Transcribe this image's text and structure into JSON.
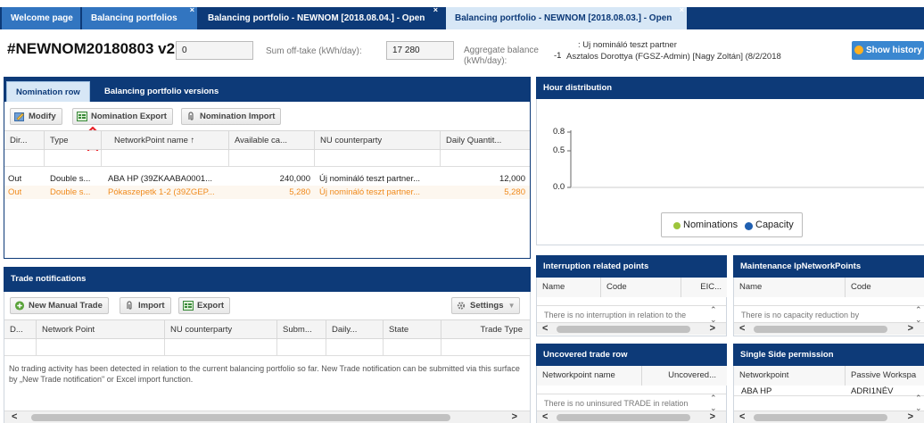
{
  "tabs": [
    {
      "label": "Welcome page"
    },
    {
      "label": "Balancing portfolios"
    },
    {
      "label": "Balancing portfolio - NEWNOM [2018.08.04.] - Open"
    },
    {
      "label": "Balancing portfolio - NEWNOM [2018.08.03.] - Open"
    }
  ],
  "header": {
    "title": "#NEWNOM20180803 v2",
    "field_left_value": "0",
    "sum_offtake_label": "Sum off-take (kWh/day):",
    "sum_offtake_value": "17 280",
    "aggregate_label": "Aggregate balance (kWh/day):",
    "aggregate_value": "-1",
    "partner_line1": ": Uj nomináló teszt partner",
    "partner_line2": "Asztalos Dorottya (FGSZ-Admin) [Nagy Zoltán] (8/2/2018",
    "show_history": "Show history"
  },
  "nomination": {
    "tabs": [
      "Nomination row",
      "Balancing portfolio versions"
    ],
    "buttons": {
      "modify": "Modify",
      "export": "Nomination Export",
      "import": "Nomination Import"
    },
    "columns": [
      "Dir...",
      "Type",
      "NetworkPoint name ↑",
      "Available ca...",
      "NU counterparty",
      "Daily Quantit..."
    ],
    "rows": [
      {
        "dir": "Out",
        "type": "Double s...",
        "point": "ABA HP (39ZKAABA0001...",
        "avail": "240,000",
        "cp": "Új nomináló teszt partner...",
        "qty": "12,000",
        "highlight": false
      },
      {
        "dir": "Out",
        "type": "Double s...",
        "point": "Pókaszepetk 1-2 (39ZGEP...",
        "avail": "5,280",
        "cp": "Új nomináló teszt partner...",
        "qty": "5,280",
        "highlight": true
      }
    ]
  },
  "hour_distribution": {
    "title": "Hour distribution",
    "yticks": [
      "0.8",
      "0.5",
      "0.0"
    ],
    "legend": [
      "Nominations",
      "Capacity"
    ],
    "colors": {
      "nominations": "#9dc53b",
      "capacity": "#1f5fb0"
    }
  },
  "trade": {
    "title": "Trade notifications",
    "buttons": {
      "new": "New Manual Trade",
      "import": "Import",
      "export": "Export",
      "settings": "Settings"
    },
    "columns": [
      "D...",
      "Network Point",
      "NU counterparty",
      "Subm...",
      "Daily...",
      "State",
      "Trade Type"
    ],
    "empty_text": "No trading activity has been detected in relation to the current balancing portfolio so far. New Trade notification can be submitted via this surface by „New Trade notification\" or Excel import function."
  },
  "interruption": {
    "title": "Interruption related points",
    "columns": [
      "Name",
      "Code",
      "EIC..."
    ],
    "empty_text": "There is no interruption in relation to the"
  },
  "maintenance": {
    "title": "Maintenance IpNetworkPoints",
    "columns": [
      "Name",
      "Code"
    ],
    "empty_text": "There is no capacity reduction by"
  },
  "uncovered": {
    "title": "Uncovered trade row",
    "columns": [
      "Networkpoint name",
      "Uncovered..."
    ],
    "empty_text": "There is no uninsured TRADE in relation"
  },
  "single_side": {
    "title": "Single Side permission",
    "columns": [
      "Networkpoint",
      "Passive Workspa"
    ],
    "rows": [
      {
        "point": "ABA HP",
        "ws": "ADRI1NÉV"
      }
    ]
  }
}
